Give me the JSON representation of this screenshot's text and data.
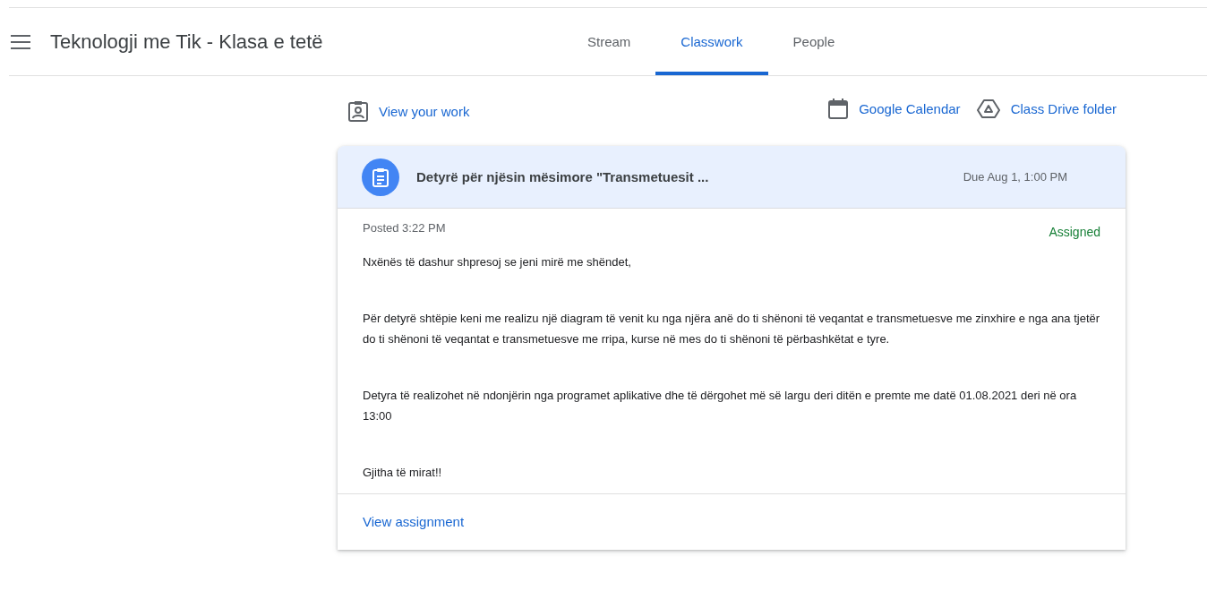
{
  "header": {
    "title": "Teknologji me Tik - Klasa e tetë"
  },
  "tabs": [
    {
      "label": "Stream",
      "selected": false
    },
    {
      "label": "Classwork",
      "selected": true
    },
    {
      "label": "People",
      "selected": false
    }
  ],
  "toolbar": {
    "view_work": "View your work",
    "calendar": "Google Calendar",
    "drive": "Class Drive folder"
  },
  "assignment": {
    "title": "Detyrë për njësin mësimore \"Transmetuesit ...",
    "due": "Due Aug 1, 1:00 PM",
    "posted": "Posted 3:22 PM",
    "status": "Assigned",
    "paragraphs": [
      "Nxënës të dashur shpresoj se jeni mirë me shëndet,",
      "Për detyrë shtëpie keni me realizu një diagram të venit ku nga njëra anë do ti shënoni të veqantat e transmetuesve me zinxhire e nga ana tjetër do ti shënoni të veqantat e transmetuesve me rripa, kurse në mes do ti shënoni të përbashkëtat e tyre.",
      "Detyra të realizohet në ndonjërin nga programet aplikative dhe të dërgohet më së largu deri ditën e premte me datë 01.08.2021 deri në ora 13:00",
      "Gjitha të mirat!!"
    ],
    "link": "View assignment"
  }
}
